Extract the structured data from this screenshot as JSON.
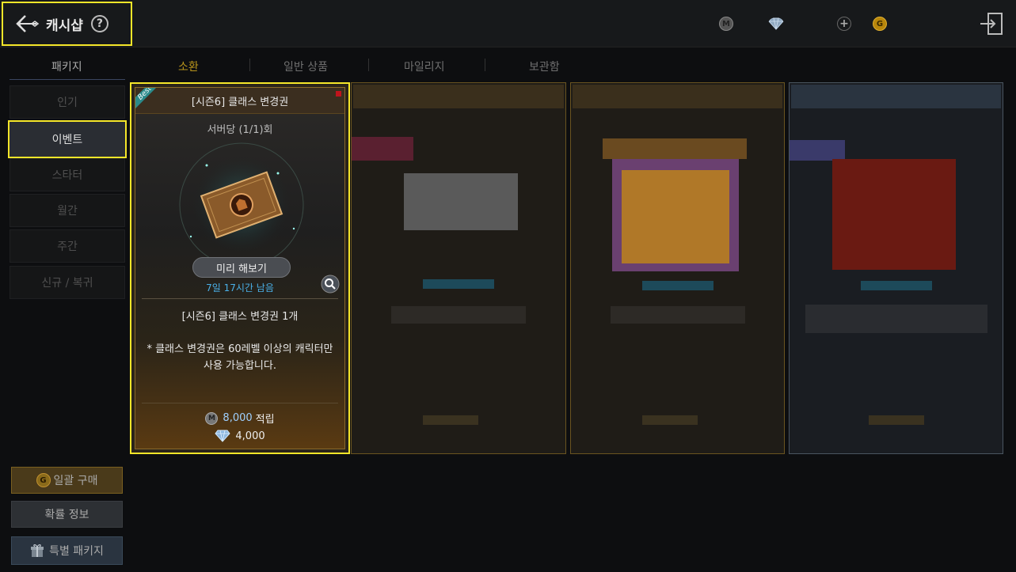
{
  "header": {
    "title": "캐시샵",
    "help_glyph": "?",
    "currencies": [
      {
        "name": "mileage-coin",
        "glyph": "M"
      },
      {
        "name": "diamond"
      },
      {
        "name": "add",
        "glyph": "+"
      },
      {
        "name": "gold-coin",
        "glyph": "G"
      }
    ]
  },
  "tabs": {
    "package": "패키지",
    "summon": "소환",
    "general": "일반 상품",
    "mileage": "마일리지",
    "storage": "보관함"
  },
  "sidebar": {
    "items": [
      {
        "label": "인기"
      },
      {
        "label": "이벤트",
        "selected": true
      },
      {
        "label": "스타터"
      },
      {
        "label": "월간"
      },
      {
        "label": "주간"
      },
      {
        "label": "신규 / 복귀"
      }
    ],
    "bulk_buy": "일괄 구매",
    "bulk_coin": "G",
    "prob_info": "확률 정보",
    "special_package": "특별 패키지"
  },
  "card": {
    "badge": "Best",
    "title": "[시즌6] 클래스 변경권",
    "limit": "서버당 (1/1)회",
    "preview": "미리 해보기",
    "timer": "7일 17시간 남음",
    "content": "[시즌6] 클래스 변경권 1개",
    "desc_line1": "* 클래스 변경권은 60레벨 이상의 캐릭터만",
    "desc_line2": "사용 가능합니다.",
    "mileage_value": "8,000",
    "mileage_label": "적립",
    "mileage_coin": "M",
    "diamond_price": "4,000"
  },
  "colors": {
    "highlight": "#f5e629",
    "accent_gold": "#b8941c",
    "timer_blue": "#4ab0e8"
  }
}
